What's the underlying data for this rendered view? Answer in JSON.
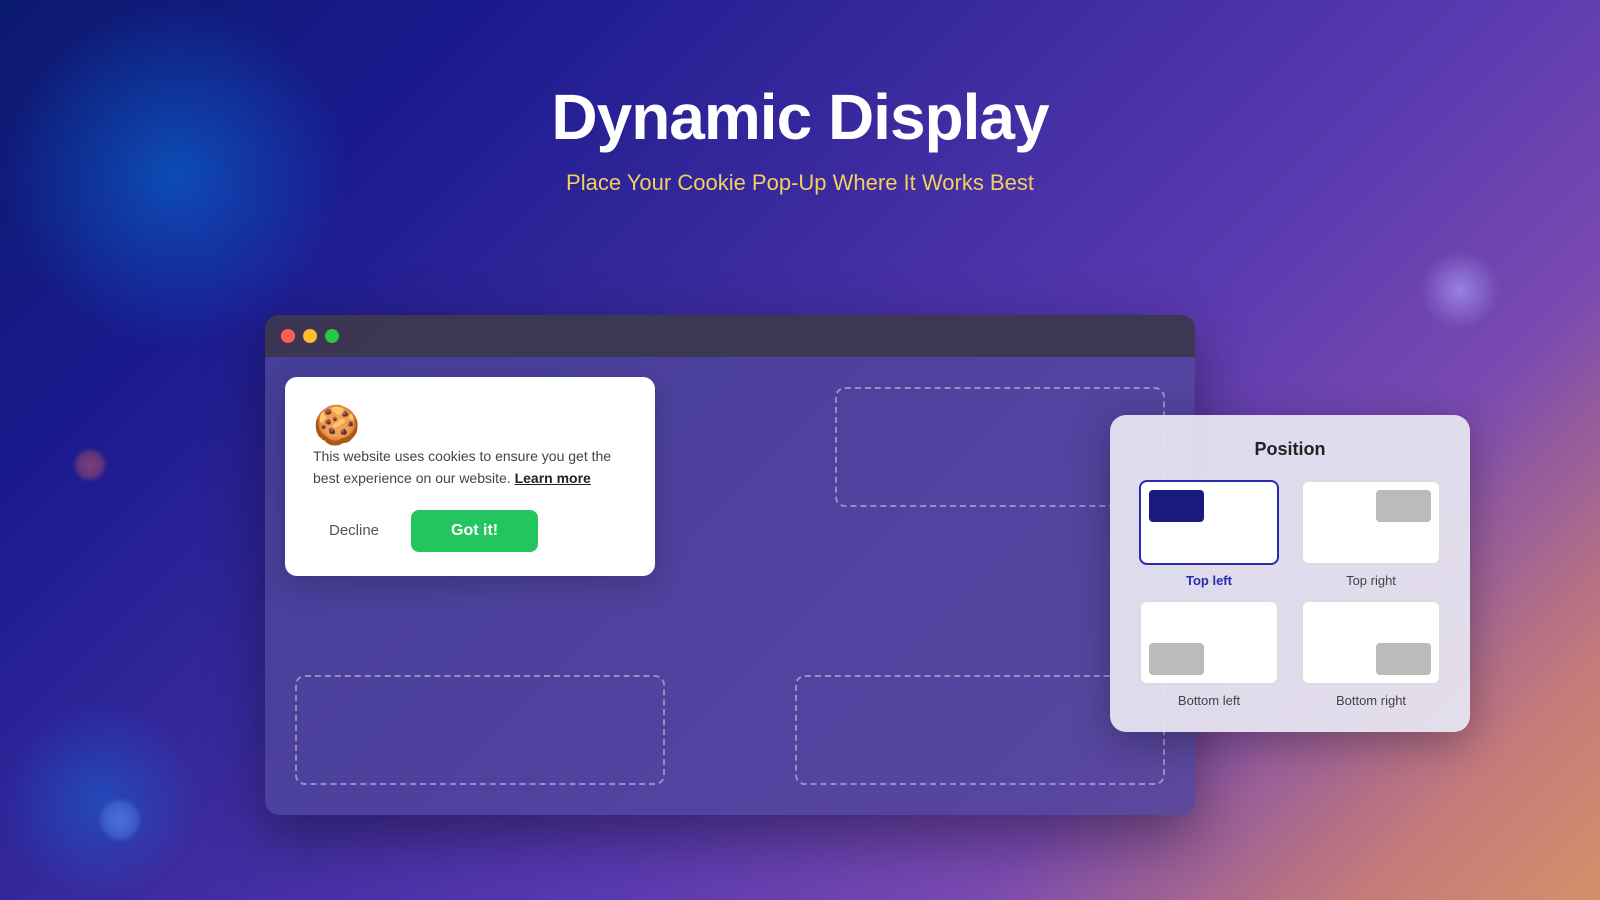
{
  "header": {
    "title": "Dynamic Display",
    "subtitle": "Place Your Cookie Pop-Up Where It Works Best"
  },
  "browser": {
    "traffic_lights": [
      "red",
      "yellow",
      "green"
    ]
  },
  "cookie_popup": {
    "icon": "🍪",
    "body_text": "This website uses cookies to ensure you get the best experience on our website.",
    "learn_more_label": "Learn more",
    "decline_label": "Decline",
    "accept_label": "Got it!"
  },
  "position_panel": {
    "title": "Position",
    "options": [
      {
        "id": "top-left",
        "label": "Top left",
        "active": true
      },
      {
        "id": "top-right",
        "label": "Top right",
        "active": false
      },
      {
        "id": "bottom-left",
        "label": "Bottom left",
        "active": false
      },
      {
        "id": "bottom-right",
        "label": "Bottom right",
        "active": false
      }
    ]
  }
}
